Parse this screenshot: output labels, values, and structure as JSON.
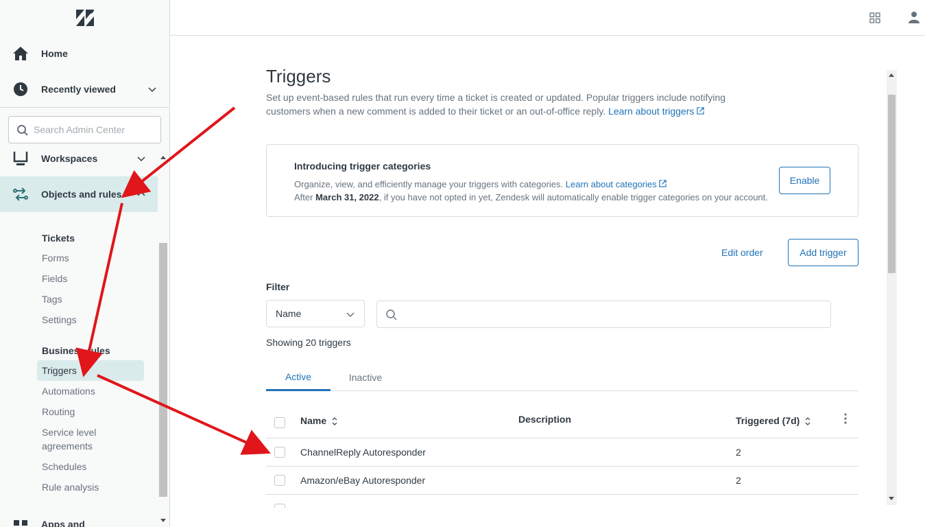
{
  "sidebar": {
    "nav": {
      "home": "Home",
      "recently_viewed": "Recently viewed",
      "workspaces": "Workspaces",
      "objects_and_rules": "Objects and rules",
      "apps_and": "Apps and"
    },
    "search": {
      "placeholder": "Search Admin Center"
    },
    "tickets": {
      "heading": "Tickets",
      "items": [
        "Forms",
        "Fields",
        "Tags",
        "Settings"
      ]
    },
    "business_rules": {
      "heading": "Business rules",
      "items": [
        "Triggers",
        "Automations",
        "Routing",
        "Service level agreements",
        "Schedules",
        "Rule analysis"
      ],
      "active": "Triggers"
    }
  },
  "page": {
    "title": "Triggers",
    "description": "Set up event-based rules that run every time a ticket is created or updated. Popular triggers include notifying customers when a new comment is added to their ticket or an out-of-office reply.",
    "learn_link": "Learn about triggers"
  },
  "banner": {
    "heading": "Introducing trigger categories",
    "line1": "Organize, view, and efficiently manage your triggers with categories.",
    "line1_link": "Learn about categories",
    "line2_prefix": "After",
    "line2_date": "March 31, 2022",
    "line2_suffix": ", if you have not opted in yet, Zendesk will automatically enable trigger categories on your account.",
    "button": "Enable"
  },
  "actions": {
    "edit_order": "Edit order",
    "add_trigger": "Add trigger"
  },
  "filter": {
    "label": "Filter",
    "select_value": "Name",
    "search_value": ""
  },
  "showing": "Showing 20 triggers",
  "tabs": {
    "active": "Active",
    "inactive": "Inactive"
  },
  "table": {
    "headers": {
      "name": "Name",
      "description": "Description",
      "triggered": "Triggered (7d)"
    },
    "rows": [
      {
        "name": "ChannelReply Autoresponder",
        "description": "",
        "triggered": "2"
      },
      {
        "name": "Amazon/eBay Autoresponder",
        "description": "",
        "triggered": "2"
      }
    ]
  },
  "colors": {
    "accent": "#1f73b7",
    "active_bg": "#daebec",
    "arrow": "#e0161b"
  }
}
